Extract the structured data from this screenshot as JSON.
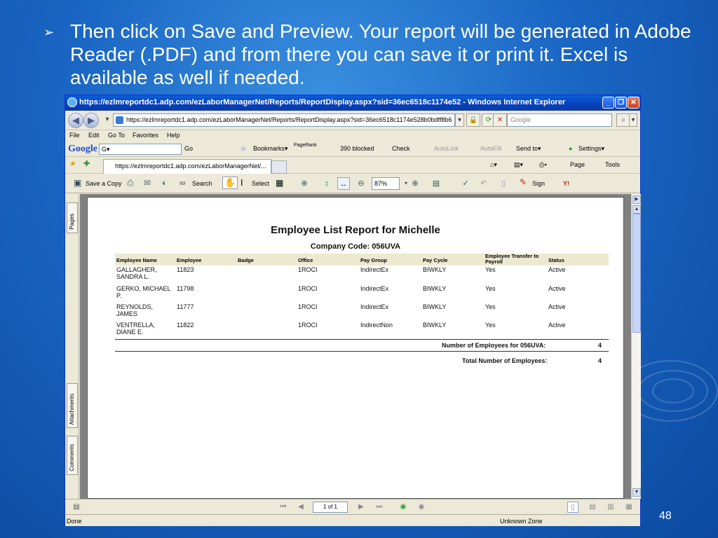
{
  "slide": {
    "bullet_text": "Then click on Save and Preview.  Your report will be generated in Adobe Reader (.PDF) and from there you can save it or print it. Excel is available as well if needed.",
    "page_number": "48"
  },
  "window": {
    "title": "https://ezlmreportdc1.adp.com/ezLaborManagerNet/Reports/ReportDisplay.aspx?sid=36ec6518c1174e52 - Windows Internet Explorer",
    "address": "https://ezlmreportdc1.adp.com/ezLaborManagerNet/Reports/ReportDisplay.aspx?sid=36ec6518c1174e528b0bdff8b6",
    "search_placeholder": "Google"
  },
  "menu": [
    "File",
    "Edit",
    "Go To",
    "Favorites",
    "Help"
  ],
  "google_toolbar": {
    "logo": "Google",
    "go": "Go",
    "bookmarks": "Bookmarks▾",
    "pagerank": "PageRank",
    "blocked": "390 blocked",
    "check": "Check",
    "autolink": "AutoLink",
    "autofill": "AutoFill",
    "sendto": "Send to▾",
    "settings": "Settings▾"
  },
  "tabs": {
    "active_tab": "https://ezlmreportdc1.adp.com/ezLaborManagerNet/...",
    "page_menu": "Page",
    "tools_menu": "Tools"
  },
  "pdf_toolbar": {
    "save_copy": "Save a Copy",
    "search": "Search",
    "select": "Select",
    "zoom": "87%",
    "sign": "Sign"
  },
  "side_tabs": [
    "Pages",
    "Attachments",
    "Comments"
  ],
  "report": {
    "title": "Employee List Report for Michelle",
    "company": "Company Code: 056UVA",
    "columns": [
      "Employee Name",
      "Employee",
      "Badge",
      "Office",
      "Pay Group",
      "Pay Cycle",
      "Employee Transfer to Payroll",
      "Status"
    ],
    "rows": [
      {
        "name": "GALLAGHER, SANDRA L.",
        "employee": "11823",
        "badge": "",
        "office": "1ROCI",
        "pay_group": "IndirectEx",
        "pay_cycle": "BIWKLY",
        "transfer": "Yes",
        "status": "Active"
      },
      {
        "name": "GERKO, MICHAEL P.",
        "employee": "11798",
        "badge": "",
        "office": "1ROCI",
        "pay_group": "IndirectEx",
        "pay_cycle": "BIWKLY",
        "transfer": "Yes",
        "status": "Active"
      },
      {
        "name": "REYNOLDS, JAMES",
        "employee": "11777",
        "badge": "",
        "office": "1ROCI",
        "pay_group": "IndirectEx",
        "pay_cycle": "BIWKLY",
        "transfer": "Yes",
        "status": "Active"
      },
      {
        "name": "VENTRELLA, DIANE E.",
        "employee": "11822",
        "badge": "",
        "office": "1ROCI",
        "pay_group": "IndirectNon",
        "pay_cycle": "BIWKLY",
        "transfer": "Yes",
        "status": "Active"
      }
    ],
    "count_label": "Number of Employees for 056UVA:",
    "count_value": "4",
    "total_label": "Total Number of Employees:",
    "total_value": "4"
  },
  "navigation": {
    "page_indicator": "1 of 1"
  },
  "status": {
    "left": "Done",
    "zone": "Unknown Zone"
  },
  "colors": {
    "slide_bg": "#1a66c4",
    "titlebar": "#0a4fc8",
    "header_row": "#ece9d0"
  }
}
